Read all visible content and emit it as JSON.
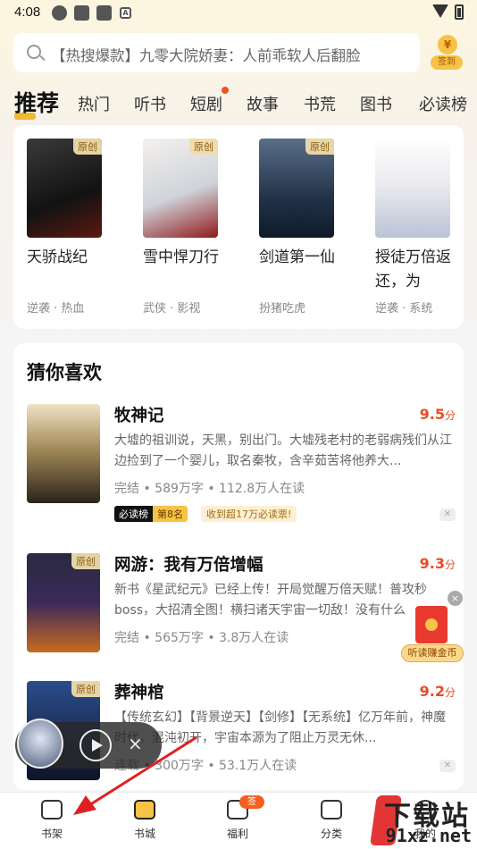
{
  "status": {
    "time": "4:08"
  },
  "search": {
    "placeholder": "【热搜爆款】九零大院娇妻：人前乖软人后翻脸",
    "signin_coin": "¥",
    "signin_label": "签到"
  },
  "tabs": [
    {
      "label": "推荐",
      "active": true
    },
    {
      "label": "热门"
    },
    {
      "label": "听书"
    },
    {
      "label": "短剧",
      "dot": true
    },
    {
      "label": "故事"
    },
    {
      "label": "书荒"
    },
    {
      "label": "图书"
    },
    {
      "label": "必读榜"
    }
  ],
  "featured": [
    {
      "title": "天骄战纪",
      "tags": "逆袭 · 热血",
      "badge": "原创"
    },
    {
      "title": "雪中悍刀行",
      "tags": "武侠 · 影视",
      "badge": "原创"
    },
    {
      "title": "剑道第一仙",
      "tags": "扮猪吃虎",
      "badge": "原创"
    },
    {
      "title": "授徒万倍返还，为",
      "tags": "逆袭 · 系统"
    }
  ],
  "recommend": {
    "section_title": "猜你喜欢",
    "items": [
      {
        "title": "牧神记",
        "score": "9.5",
        "score_unit": "分",
        "desc": "大墟的祖训说，天黑，别出门。大墟残老村的老弱病残们从江边捡到了一个婴儿，取名秦牧，含辛茹苦将他养大...",
        "meta": "完结 • 589万字 • 112.8万人在读",
        "tag_a": "必读榜",
        "tag_b": "第8名",
        "tag_c": "收到超17万必读票!"
      },
      {
        "title": "网游：我有万倍增幅",
        "score": "9.3",
        "score_unit": "分",
        "desc": "新书《星武纪元》已经上传！开局觉醒万倍天赋！普攻秒boss，大招清全图！横扫诸天宇宙一切敌！没有什么",
        "meta": "完结 • 565万字 • 3.8万人在读",
        "badge": "原创"
      },
      {
        "title": "葬神棺",
        "score": "9.2",
        "score_unit": "分",
        "desc": "【传统玄幻】【背景逆天】【剑修】【无系统】亿万年前，神魔时代，混沌初开，宇宙本源为了阻止万灵无休...",
        "meta": "连载 • 300万字 • 53.1万人在读",
        "badge": "原创"
      }
    ]
  },
  "float_widget": {
    "label": "听读赚金币",
    "close": "×"
  },
  "player": {
    "close": "×"
  },
  "bottom_nav": [
    {
      "label": "书架"
    },
    {
      "label": "书城",
      "active": true
    },
    {
      "label": "福利",
      "badge": "签到"
    },
    {
      "label": "分类"
    },
    {
      "label": "我的"
    }
  ],
  "watermark": {
    "text1": "下载站",
    "text2": "91xz.net"
  },
  "colors": {
    "accent": "#f6c344",
    "score": "#ea4b26",
    "arrow": "#e02020"
  }
}
